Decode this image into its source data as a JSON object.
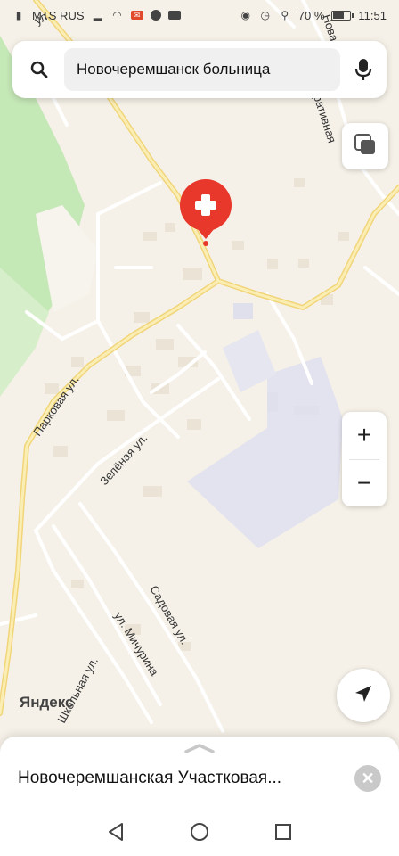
{
  "status_bar": {
    "carrier": "MTS RUS",
    "battery_percent": "70 %",
    "battery_level": 0.7,
    "time": "11:51"
  },
  "search": {
    "query": "Новочеремшанск больница"
  },
  "map": {
    "logo": "Яндекс",
    "street_labels": {
      "parkovaya": "Парковая ул.",
      "zelenaya": "Зелёная ул.",
      "sadovaya": "Садовая ул.",
      "michurina": "ул. Мичурина",
      "shkolnaya": "Школьная ул.",
      "kooperativnaya": "ративная",
      "nova": "Нова",
      "top_left": "ул."
    },
    "marker_icon": "hospital-marker-icon"
  },
  "controls": {
    "zoom_in": "+",
    "zoom_out": "−",
    "layers_icon": "layers-icon",
    "locate_icon": "navigation-arrow-icon"
  },
  "place_card": {
    "title": "Новочеремшанская Участковая..."
  },
  "nav": {
    "back_icon": "back-triangle-icon",
    "home_icon": "home-circle-icon",
    "recents_icon": "recents-square-icon"
  },
  "colors": {
    "marker": "#e8372b",
    "road_major": "#f7e08a",
    "map_bg": "#f5f1e8",
    "park": "#c5e8b7",
    "industrial": "#e3e3ef"
  }
}
